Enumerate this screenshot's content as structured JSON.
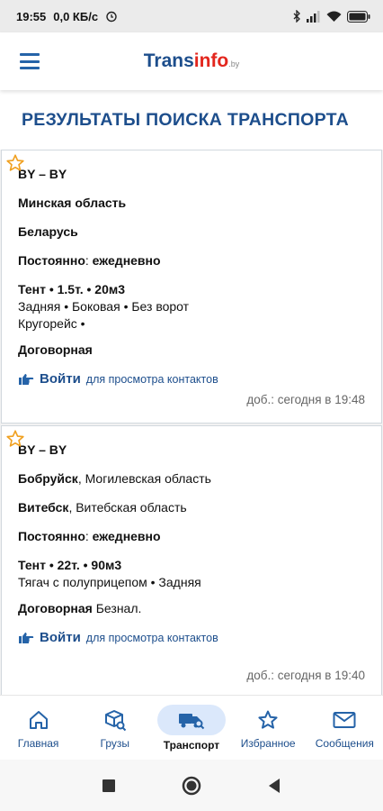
{
  "status_bar": {
    "time": "19:55",
    "speed": "0,0 КБ/с"
  },
  "header": {
    "logo_main": "Trans",
    "logo_accent": "info",
    "logo_domain": ".by"
  },
  "page_title": "РЕЗУЛЬТАТЫ ПОИСКА ТРАНСПОРТА",
  "cards": [
    {
      "route": "BY – BY",
      "from_bold": "Минская область",
      "from_rest": "",
      "to_bold": "Беларусь",
      "to_rest": "",
      "schedule_bold": "Постоянно",
      "schedule_rest": ": ",
      "schedule_bold2": "ежедневно",
      "vehicle": "Тент • 1.5т. • 20м3",
      "body": "Задняя • Боковая • Без ворот",
      "extra": "Кругорейс  •",
      "price_bold": "Договорная",
      "price_rest": "",
      "login_label": "Войти",
      "login_hint": "для просмотра контактов",
      "added": "доб.: сегодня в 19:48"
    },
    {
      "route": "BY – BY",
      "from_bold": "Бобруйск",
      "from_rest": ", Могилевская область",
      "to_bold": "Витебск",
      "to_rest": ", Витебская область",
      "schedule_bold": "Постоянно",
      "schedule_rest": ": ",
      "schedule_bold2": "ежедневно",
      "vehicle": "Тент • 22т. • 90м3",
      "body": "Тягач с полуприцепом • Задняя",
      "extra": "",
      "price_bold": "Договорная",
      "price_rest": " Безнал.",
      "login_label": "Войти",
      "login_hint": "для просмотра контактов",
      "added": "доб.: сегодня в 19:40"
    }
  ],
  "bottom_nav": [
    {
      "label": "Главная",
      "icon": "home-icon"
    },
    {
      "label": "Грузы",
      "icon": "package-search-icon"
    },
    {
      "label": "Транспорт",
      "icon": "truck-search-icon",
      "active": true
    },
    {
      "label": "Избранное",
      "icon": "star-icon"
    },
    {
      "label": "Сообщения",
      "icon": "mail-icon"
    }
  ],
  "colors": {
    "primary": "#1d4e8c",
    "accent": "#e3261d",
    "star": "#f0a020",
    "active_bg": "#dbe8fb"
  }
}
